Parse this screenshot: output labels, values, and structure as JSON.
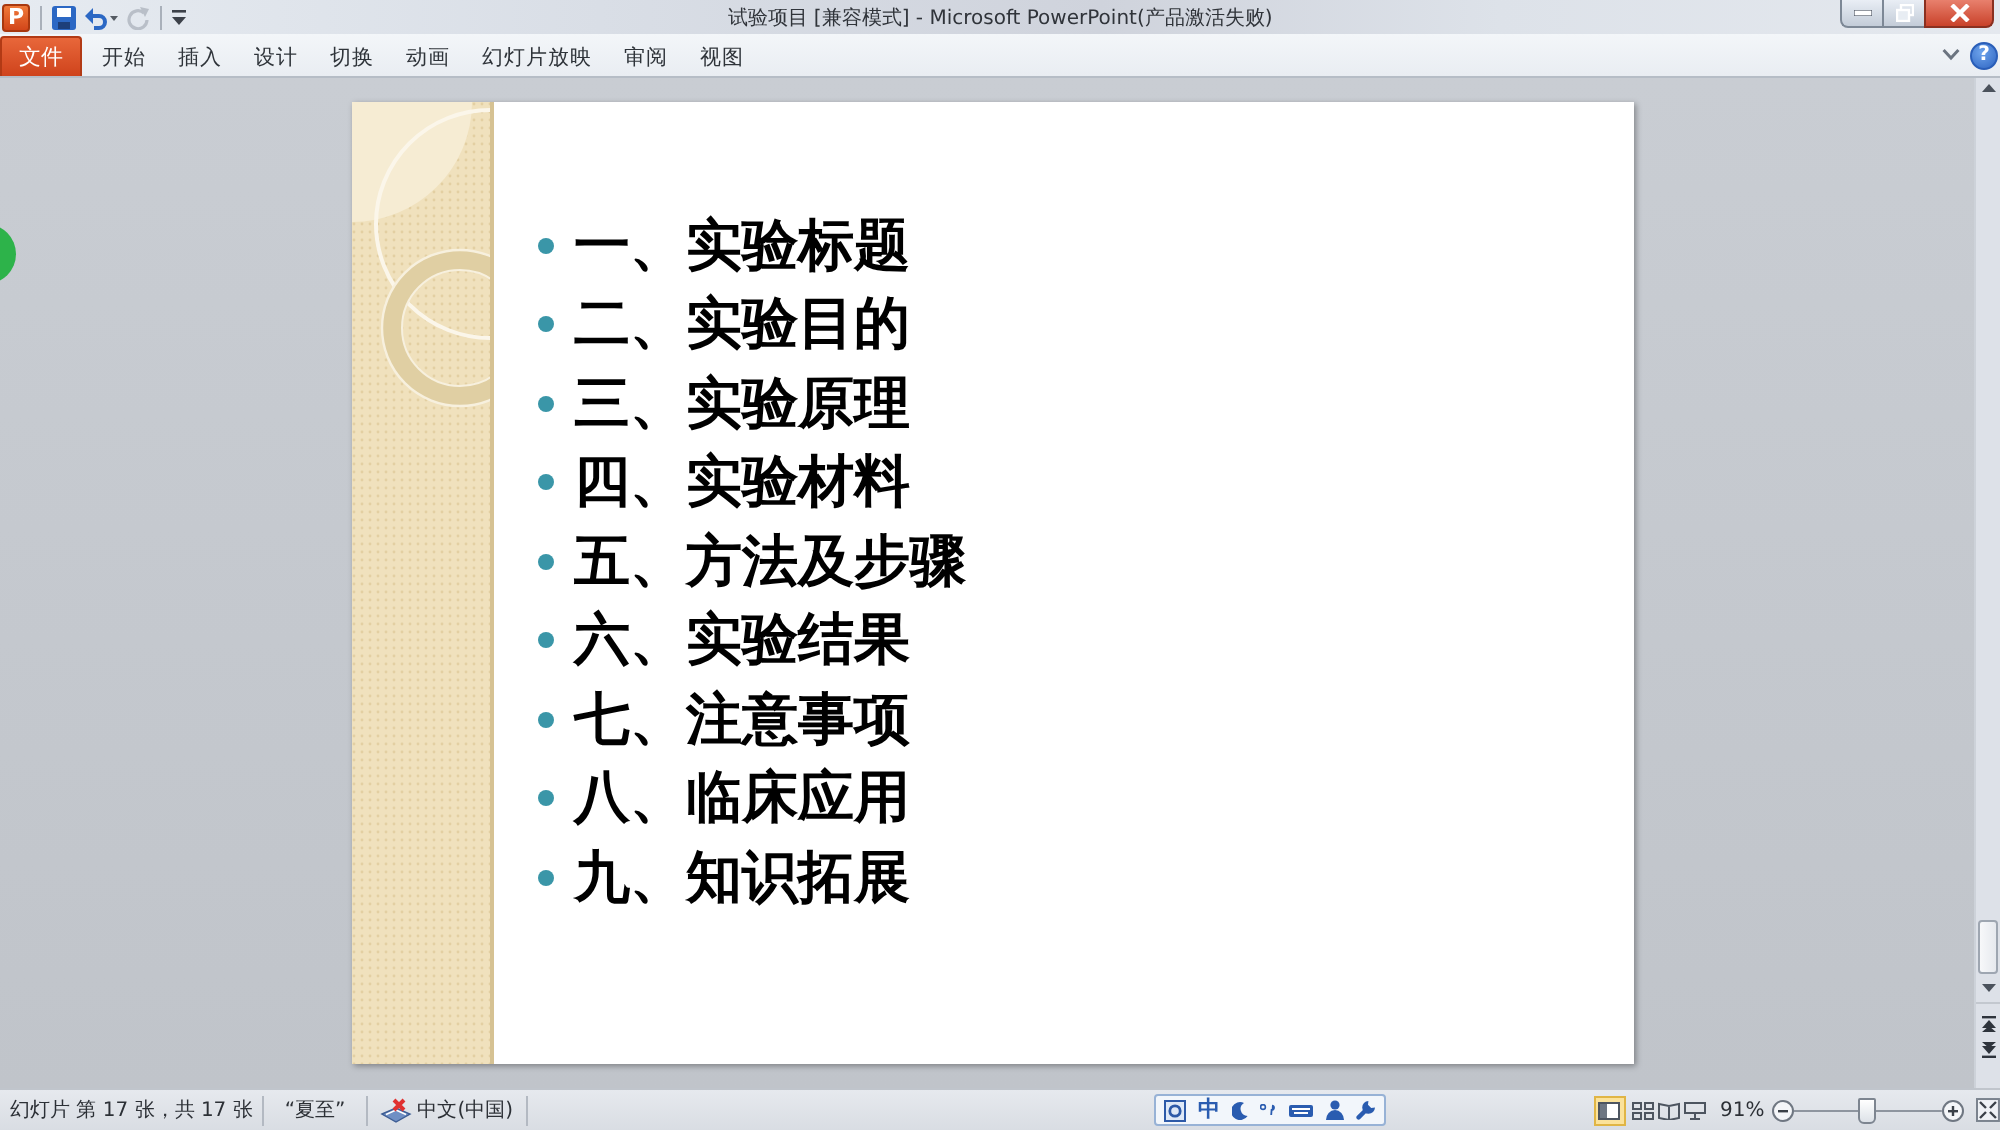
{
  "window": {
    "app_logo": "P",
    "title": "试验项目 [兼容模式] - Microsoft PowerPoint(产品激活失败)",
    "quick_access": [
      {
        "kind": "save",
        "disabled": false
      },
      {
        "kind": "undo",
        "disabled": false
      },
      {
        "kind": "redo",
        "disabled": true
      },
      {
        "kind": "customize",
        "disabled": false
      }
    ]
  },
  "ribbon": {
    "file_tab": "文件",
    "tabs": [
      {
        "label": "开始",
        "selected": false
      },
      {
        "label": "插入",
        "selected": false
      },
      {
        "label": "设计",
        "selected": false
      },
      {
        "label": "切换",
        "selected": false
      },
      {
        "label": "动画",
        "selected": false
      },
      {
        "label": "幻灯片放映",
        "selected": false
      },
      {
        "label": "审阅",
        "selected": false
      },
      {
        "label": "视图",
        "selected": false
      }
    ],
    "help": "?"
  },
  "slide": {
    "bullets": [
      "一、实验标题",
      "二、实验目的",
      "三、实验原理",
      "四、实验材料",
      "五、方法及步骤",
      "六、实验结果",
      "七、注意事项",
      "八、临床应用",
      "九、知识拓展"
    ]
  },
  "status_bar": {
    "slide_info": "幻灯片 第 17 张，共 17 张",
    "theme": "“夏至”",
    "language": "中文(中国)",
    "ime": {
      "mode": "中"
    },
    "views": [
      {
        "kind": "normal",
        "selected": true
      },
      {
        "kind": "sorter",
        "selected": false
      },
      {
        "kind": "reading",
        "selected": false
      },
      {
        "kind": "slideshow",
        "selected": false
      }
    ],
    "zoom": {
      "reading": "91%",
      "level": 0.47
    }
  }
}
